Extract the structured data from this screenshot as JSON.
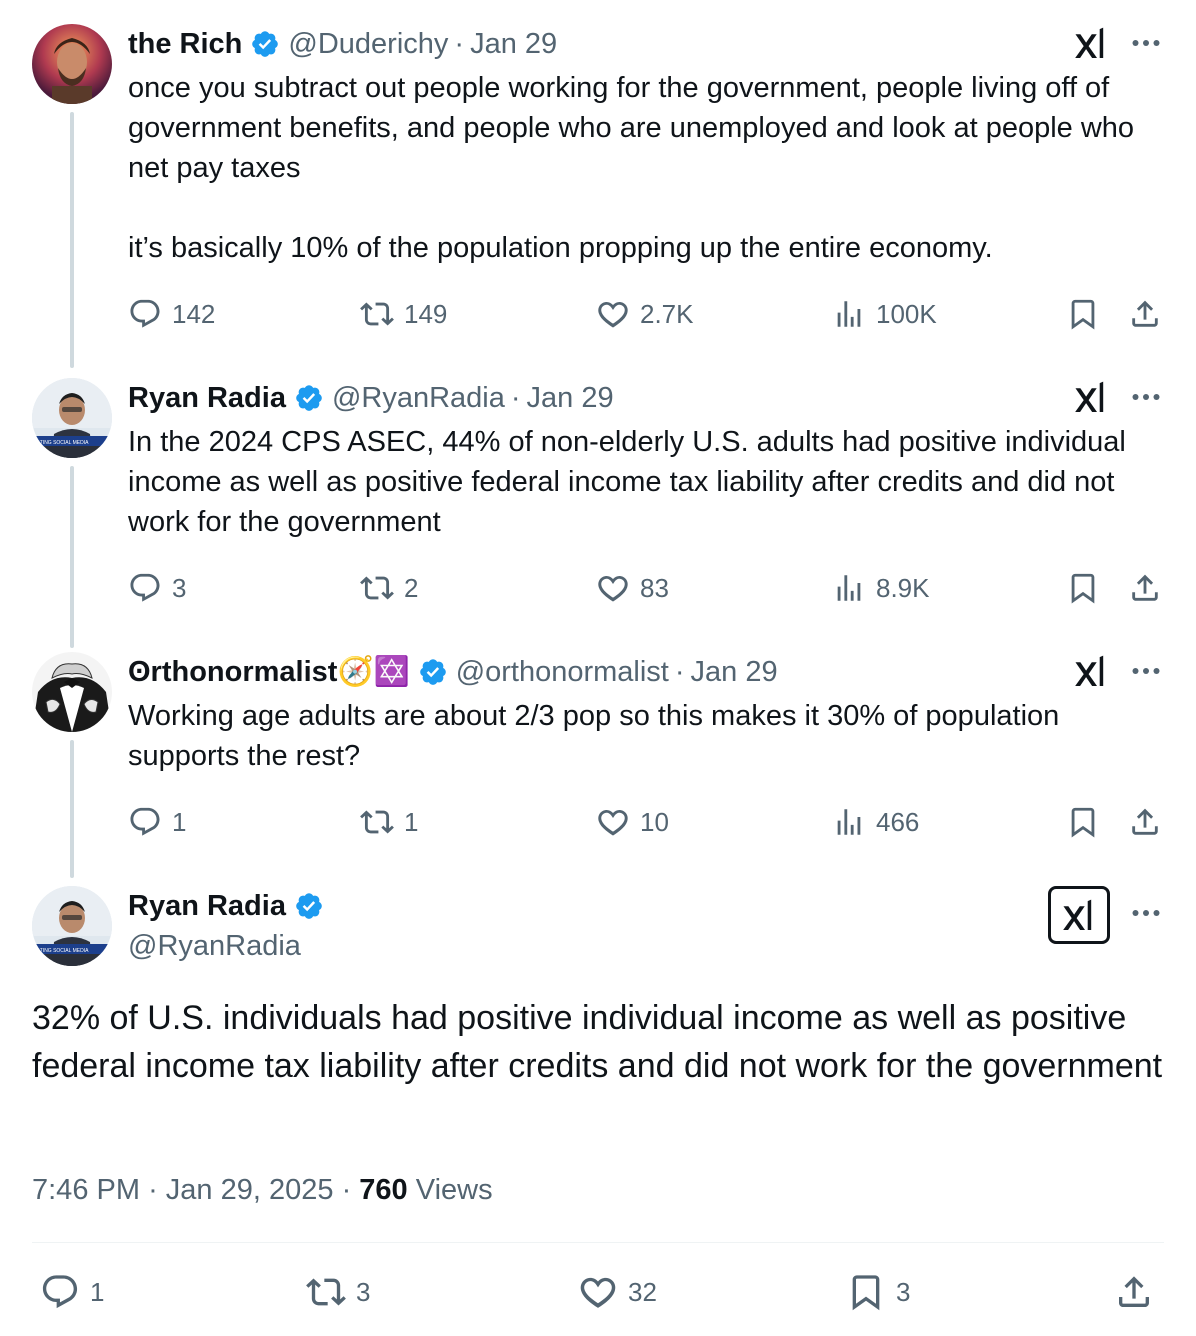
{
  "tweets": [
    {
      "name": "the Rich",
      "handle": "@Duderichy",
      "date": "Jan 29",
      "text": "once you subtract out people working for the government, people living off of government benefits, and people who are unemployed and look at people who net pay taxes\n\nit’s basically 10% of the population propping up the entire economy.",
      "replies": "142",
      "reposts": "149",
      "likes": "2.7K",
      "views": "100K"
    },
    {
      "name": "Ryan Radia",
      "handle": "@RyanRadia",
      "date": "Jan 29",
      "text": "In the 2024 CPS ASEC, 44% of non-elderly U.S. adults had positive individual income as well as positive federal income tax liability after credits and did not work for the government",
      "replies": "3",
      "reposts": "2",
      "likes": "83",
      "views": "8.9K"
    },
    {
      "name": "ʘrthonormalist🧭✡️",
      "handle": "@orthonormalist",
      "date": "Jan 29",
      "text": "Working age adults are about 2/3 pop so this makes it 30% of population supports the rest?",
      "replies": "1",
      "reposts": "1",
      "likes": "10",
      "views": "466"
    }
  ],
  "main": {
    "name": "Ryan Radia",
    "handle": "@RyanRadia",
    "text": "32% of U.S. individuals had positive individual income as well as positive federal income tax liability after credits and did not work for the government",
    "time": "7:46 PM",
    "date": "Jan 29, 2025",
    "views_count": "760",
    "views_label": "Views",
    "replies": "1",
    "reposts": "3",
    "likes": "32",
    "bookmarks": "3"
  },
  "ui": {
    "separator": "·",
    "icons": [
      "reply-icon",
      "repost-icon",
      "like-icon",
      "views-icon",
      "bookmark-icon",
      "share-icon",
      "grok-icon",
      "more-icon",
      "verified-badge-icon"
    ]
  },
  "colors": {
    "text": "#0f1419",
    "muted": "#536471",
    "verified": "#1d9bf0",
    "thread_line": "#cfd9de",
    "divider": "#eff3f4"
  }
}
